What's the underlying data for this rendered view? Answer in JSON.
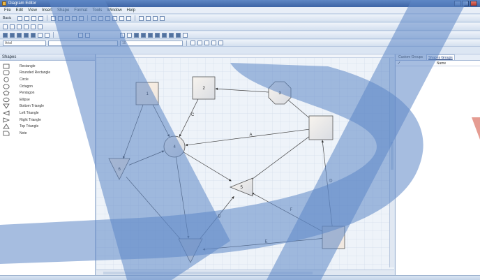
{
  "window": {
    "title": "Diagram Editor"
  },
  "menu": [
    "File",
    "Edit",
    "View",
    "Insert",
    "Shape",
    "Format",
    "Tools",
    "Window",
    "Help"
  ],
  "toolbar1": {
    "label": "Basic"
  },
  "toolbar4": {
    "font_combo": "Arial",
    "size_combo": "10"
  },
  "shapes_panel": {
    "header": "Shapes",
    "items": [
      {
        "label": "Rectangle",
        "icon": "rectangle-icon"
      },
      {
        "label": "Rounded Rectangle",
        "icon": "rounded-rectangle-icon"
      },
      {
        "label": "Circle",
        "icon": "circle-icon"
      },
      {
        "label": "Octagon",
        "icon": "octagon-icon"
      },
      {
        "label": "Pentagon",
        "icon": "pentagon-icon"
      },
      {
        "label": "Ellipse",
        "icon": "ellipse-icon"
      },
      {
        "label": "Bottom Triangle",
        "icon": "bottom-triangle-icon"
      },
      {
        "label": "Left Triangle",
        "icon": "left-triangle-icon"
      },
      {
        "label": "Right Triangle",
        "icon": "right-triangle-icon"
      },
      {
        "label": "Top Triangle",
        "icon": "top-triangle-icon"
      },
      {
        "label": "Note",
        "icon": "note-icon"
      }
    ]
  },
  "diagram": {
    "nodes": [
      {
        "id": "n1",
        "shape": "square",
        "label": "1"
      },
      {
        "id": "n2",
        "shape": "square",
        "label": "2"
      },
      {
        "id": "n3",
        "shape": "octagon",
        "label": "3"
      },
      {
        "id": "n4",
        "shape": "circle",
        "label": "4"
      },
      {
        "id": "n5",
        "shape": "square",
        "label": ""
      },
      {
        "id": "n6",
        "shape": "triangle-down",
        "label": "6"
      },
      {
        "id": "n7",
        "shape": "triangle-left",
        "label": "5"
      },
      {
        "id": "n8",
        "shape": "triangle-down",
        "label": ""
      },
      {
        "id": "n9",
        "shape": "square",
        "label": ""
      }
    ],
    "edges": [
      {
        "from": "n3",
        "to": "n2",
        "label": ""
      },
      {
        "from": "n1",
        "to": "n4",
        "label": ""
      },
      {
        "from": "n2",
        "to": "n4",
        "label": "C"
      },
      {
        "from": "n1",
        "to": "n6",
        "label": ""
      },
      {
        "from": "n6",
        "to": "n4",
        "label": ""
      },
      {
        "from": "n5",
        "to": "n4",
        "label": "A"
      },
      {
        "from": "n3",
        "to": "n5",
        "label": ""
      },
      {
        "from": "n4",
        "to": "n7",
        "label": ""
      },
      {
        "from": "n5",
        "to": "n7",
        "label": ""
      },
      {
        "from": "n4",
        "to": "n8",
        "label": ""
      },
      {
        "from": "n6",
        "to": "n8",
        "label": ""
      },
      {
        "from": "n8",
        "to": "n7",
        "label": "B"
      },
      {
        "from": "n9",
        "to": "n7",
        "label": "F"
      },
      {
        "from": "n9",
        "to": "n8",
        "label": "E"
      },
      {
        "from": "n9",
        "to": "n5",
        "label": "D"
      }
    ]
  },
  "right_panel": {
    "tabs": [
      "Custom Groups",
      "Shapes Groups"
    ],
    "active_tab": 1,
    "column": "Name"
  },
  "colors": {
    "accent": "#3d64a5",
    "watermark": "#5c86c6"
  }
}
